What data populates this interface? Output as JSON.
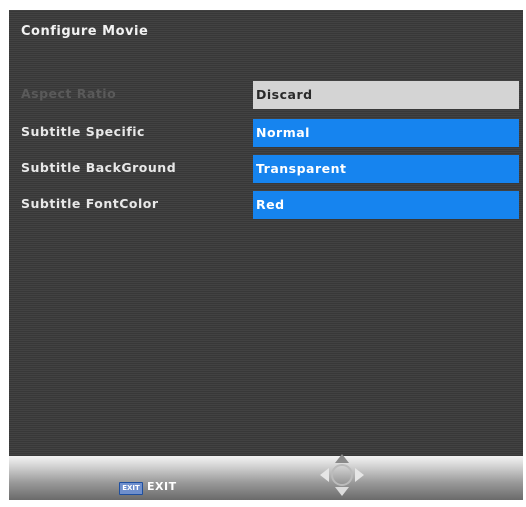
{
  "window": {
    "title": "Configure Movie"
  },
  "settings": [
    {
      "label": "Aspect Ratio",
      "value": "Discard",
      "selected": true
    },
    {
      "label": "Subtitle Specific",
      "value": "Normal",
      "selected": false
    },
    {
      "label": "Subtitle BackGround",
      "value": "Transparent",
      "selected": false
    },
    {
      "label": "Subtitle FontColor",
      "value": "Red",
      "selected": false
    }
  ],
  "footer": {
    "exit_key": "EXIT",
    "exit_label": "EXIT",
    "nav_icon": "dpad-arrows-icon"
  },
  "colors": {
    "background": "#3e3e3e",
    "value_highlight": "#1684ef",
    "selected_value": "#d4d4d4"
  }
}
